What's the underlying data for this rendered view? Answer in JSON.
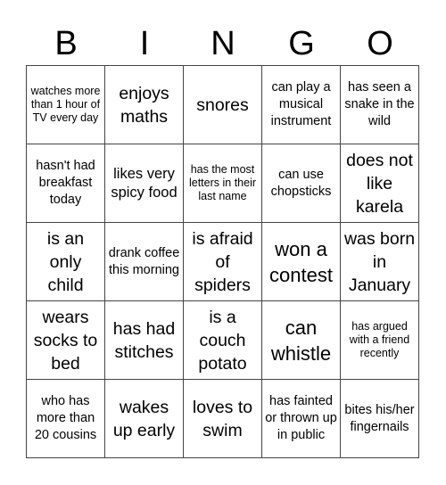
{
  "header": {
    "letters": [
      "B",
      "I",
      "N",
      "G",
      "O"
    ]
  },
  "grid": {
    "rows": [
      [
        "watches more than 1 hour of TV every day",
        "enjoys maths",
        "snores",
        "can play a musical instrument",
        "has seen a snake in the wild"
      ],
      [
        "hasn't had breakfast today",
        "likes very spicy food",
        "has the most letters in their last name",
        "can use chopsticks",
        "does not like karela"
      ],
      [
        "is an only child",
        "drank coffee this morning",
        "is afraid of spiders",
        "won a contest",
        "was born in January"
      ],
      [
        "wears socks to bed",
        "has had stitches",
        "is a couch potato",
        "can whistle",
        "has argued with a friend recently"
      ],
      [
        "who has more than 20 cousins",
        "wakes up early",
        "loves to swim",
        "has fainted or thrown up in public",
        "bites his/her fingernails"
      ]
    ]
  }
}
